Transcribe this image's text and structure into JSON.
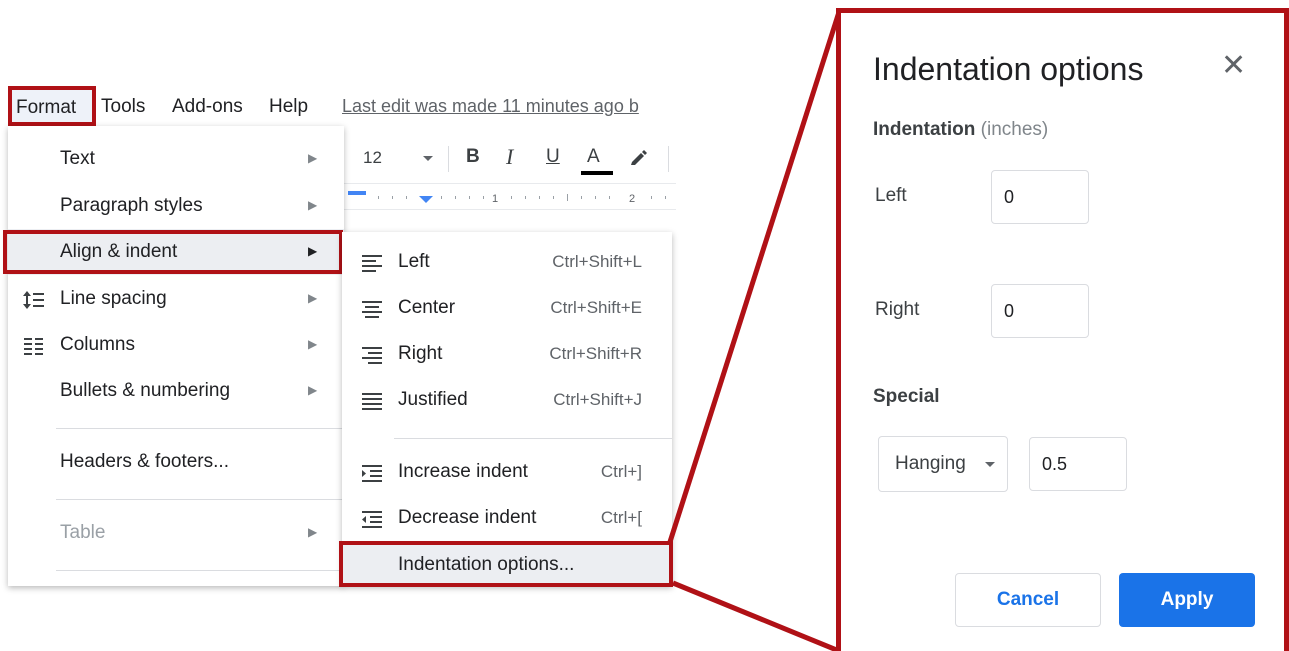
{
  "menubar": {
    "format": "Format",
    "tools": "Tools",
    "addons": "Add-ons",
    "help": "Help",
    "last_edit": "Last edit was made 11 minutes ago b"
  },
  "toolbar": {
    "font_size": "12",
    "bold": "B",
    "italic": "I",
    "underline": "U",
    "text_color": "A",
    "text_color_value": "#000000"
  },
  "ruler": {
    "mark_1": "1",
    "mark_2": "2"
  },
  "format_menu": {
    "items": [
      {
        "label": "Text",
        "submenu": true,
        "disabled": false
      },
      {
        "label": "Paragraph styles",
        "submenu": true,
        "disabled": false
      },
      {
        "label": "Align & indent",
        "submenu": true,
        "disabled": false,
        "highlighted": true
      },
      {
        "label": "Line spacing",
        "submenu": true,
        "icon": "line-spacing-icon",
        "disabled": false
      },
      {
        "label": "Columns",
        "submenu": true,
        "icon": "columns-icon",
        "disabled": false
      },
      {
        "label": "Bullets & numbering",
        "submenu": true,
        "disabled": false
      },
      {
        "label": "Headers & footers...",
        "submenu": false,
        "disabled": false
      },
      {
        "label": "Table",
        "submenu": true,
        "disabled": true
      }
    ]
  },
  "align_menu": {
    "items": [
      {
        "label": "Left",
        "shortcut": "Ctrl+Shift+L",
        "icon": "align-left-icon"
      },
      {
        "label": "Center",
        "shortcut": "Ctrl+Shift+E",
        "icon": "align-center-icon"
      },
      {
        "label": "Right",
        "shortcut": "Ctrl+Shift+R",
        "icon": "align-right-icon"
      },
      {
        "label": "Justified",
        "shortcut": "Ctrl+Shift+J",
        "icon": "align-justify-icon"
      },
      {
        "label": "Increase indent",
        "shortcut": "Ctrl+]",
        "icon": "indent-increase-icon"
      },
      {
        "label": "Decrease indent",
        "shortcut": "Ctrl+[",
        "icon": "indent-decrease-icon"
      },
      {
        "label": "Indentation options...",
        "shortcut": "",
        "highlighted": true
      }
    ]
  },
  "dialog": {
    "title": "Indentation options",
    "section": "Indentation",
    "section_unit": "(inches)",
    "left_label": "Left",
    "left_value": "0",
    "right_label": "Right",
    "right_value": "0",
    "special_label": "Special",
    "special_select": "Hanging",
    "special_value": "0.5",
    "cancel": "Cancel",
    "apply": "Apply"
  },
  "colors": {
    "highlight_border": "#b01116",
    "primary_blue": "#1a73e8"
  }
}
